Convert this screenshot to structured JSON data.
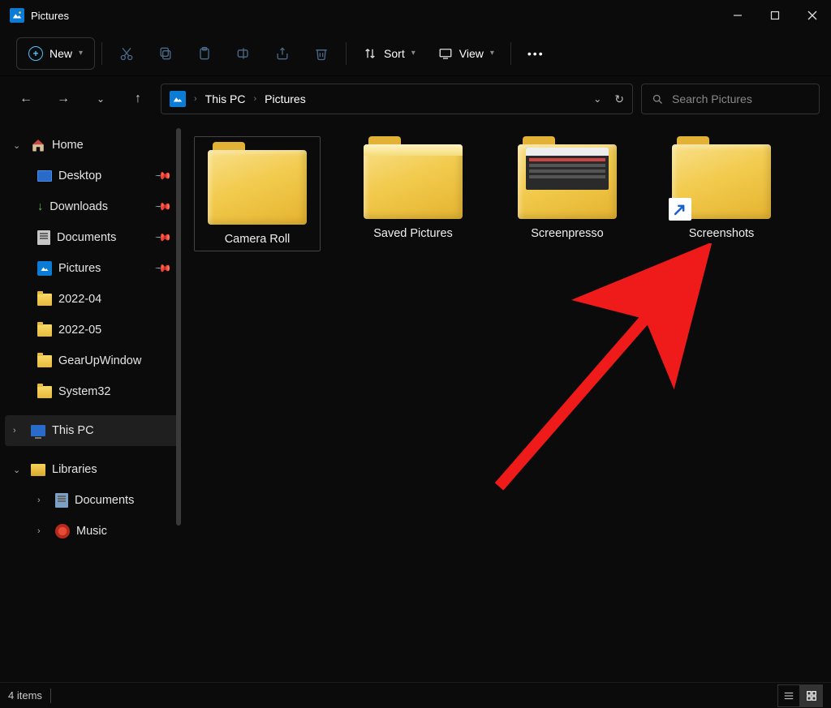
{
  "window": {
    "title": "Pictures"
  },
  "toolbar": {
    "new_label": "New",
    "sort_label": "Sort",
    "view_label": "View"
  },
  "breadcrumb": {
    "items": [
      "This PC",
      "Pictures"
    ]
  },
  "search": {
    "placeholder": "Search Pictures"
  },
  "sidebar": {
    "home": "Home",
    "desktop": "Desktop",
    "downloads": "Downloads",
    "documents": "Documents",
    "pictures": "Pictures",
    "f2022_04": "2022-04",
    "f2022_05": "2022-05",
    "gearup": "GearUpWindow",
    "system32": "System32",
    "thispc": "This PC",
    "libraries": "Libraries",
    "lib_documents": "Documents",
    "lib_music": "Music"
  },
  "folders": {
    "camera_roll": "Camera Roll",
    "saved_pictures": "Saved Pictures",
    "screenpresso": "Screenpresso",
    "screenshots": "Screenshots"
  },
  "status": {
    "count": "4 items"
  }
}
